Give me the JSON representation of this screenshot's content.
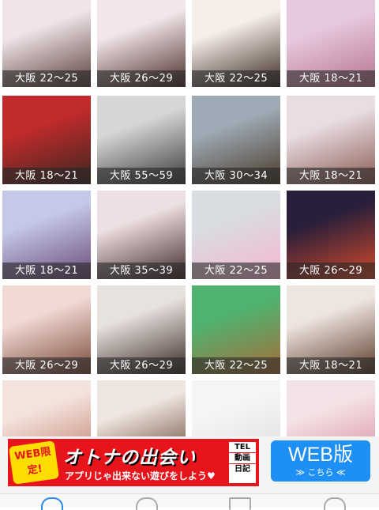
{
  "profiles": [
    {
      "label": "大阪 22〜25",
      "colors": [
        "#f0e4e8",
        "#5a3f3a"
      ]
    },
    {
      "label": "大阪 26〜29",
      "colors": [
        "#f3e6ea",
        "#4a2d28"
      ]
    },
    {
      "label": "大阪 22〜25",
      "colors": [
        "#f7eee8",
        "#3a2a22"
      ]
    },
    {
      "label": "大阪 18〜21",
      "colors": [
        "#e7c9df",
        "#b8748f"
      ]
    },
    {
      "label": "大阪 18〜21",
      "colors": [
        "#c22b2b",
        "#3b2620"
      ]
    },
    {
      "label": "大阪 55〜59",
      "colors": [
        "#d6d6d6",
        "#3a3a3a"
      ]
    },
    {
      "label": "大阪 30〜34",
      "colors": [
        "#9eaab5",
        "#4a3a2a"
      ]
    },
    {
      "label": "大阪 18〜21",
      "colors": [
        "#e9dde3",
        "#8a5a50"
      ]
    },
    {
      "label": "大阪 18〜21",
      "colors": [
        "#c5c8e9",
        "#6a4a7a"
      ]
    },
    {
      "label": "大阪 35〜39",
      "colors": [
        "#eedfe2",
        "#402a2a"
      ]
    },
    {
      "label": "大阪 22〜25",
      "colors": [
        "#d9dce0",
        "#f5b6d2"
      ]
    },
    {
      "label": "大阪 26〜29",
      "colors": [
        "#2a1f3a",
        "#d44a2a"
      ]
    },
    {
      "label": "大阪 26〜29",
      "colors": [
        "#f2d9d4",
        "#7a4a3a"
      ]
    },
    {
      "label": "大阪 26〜29",
      "colors": [
        "#e8e2df",
        "#3a2a25"
      ]
    },
    {
      "label": "大阪 22〜25",
      "colors": [
        "#4fb36f",
        "#a86b3a"
      ]
    },
    {
      "label": "大阪 18〜21",
      "colors": [
        "#efe5e0",
        "#5a3a2a"
      ]
    },
    {
      "label": "",
      "colors": [
        "#f3e3dc",
        "#c07a6a"
      ]
    },
    {
      "label": "",
      "colors": [
        "#f0e6e0",
        "#5a3a28"
      ]
    },
    {
      "label": "",
      "colors": [
        "#f5f5f5",
        "#dcdcdc"
      ]
    },
    {
      "label": "",
      "colors": [
        "#f4e3e6",
        "#d98aa0"
      ]
    }
  ],
  "ad": {
    "badge": "WEB限定!",
    "title": "オトナの出会い",
    "subtitle": "アプリじゃ出来ない遊びをしよう♥",
    "tel": [
      "TEL",
      "動画",
      "日記"
    ]
  },
  "web_button": {
    "title": "WEB版",
    "sub": "≫ こちら ≪"
  }
}
